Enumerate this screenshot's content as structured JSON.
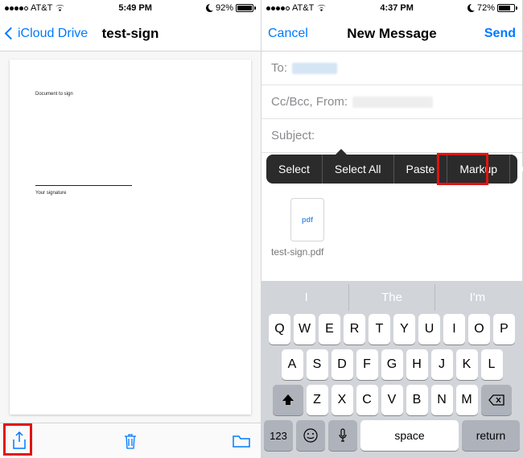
{
  "left": {
    "status": {
      "carrier": "AT&T",
      "time": "5:49 PM",
      "battery_pct": "92%",
      "battery_fill": 18
    },
    "nav": {
      "back": "iCloud Drive",
      "title": "test-sign"
    },
    "document": {
      "heading": "Document to sign",
      "sig_label": "Your signature"
    }
  },
  "right": {
    "status": {
      "carrier": "AT&T",
      "time": "4:37 PM",
      "battery_pct": "72%",
      "battery_fill": 14
    },
    "nav": {
      "cancel": "Cancel",
      "title": "New Message",
      "send": "Send"
    },
    "fields": {
      "to": "To:",
      "ccbcc": "Cc/Bcc, From:",
      "subject": "Subject:"
    },
    "context_menu": [
      "Select",
      "Select All",
      "Paste",
      "Markup"
    ],
    "attachment": {
      "badge": "pdf",
      "name": "test-sign.pdf"
    },
    "keyboard": {
      "predictions": [
        "I",
        "The",
        "I'm"
      ],
      "row1": [
        "Q",
        "W",
        "E",
        "R",
        "T",
        "Y",
        "U",
        "I",
        "O",
        "P"
      ],
      "row2": [
        "A",
        "S",
        "D",
        "F",
        "G",
        "H",
        "J",
        "K",
        "L"
      ],
      "row3": [
        "Z",
        "X",
        "C",
        "V",
        "B",
        "N",
        "M"
      ],
      "numkey": "123",
      "space": "space",
      "return": "return"
    }
  }
}
